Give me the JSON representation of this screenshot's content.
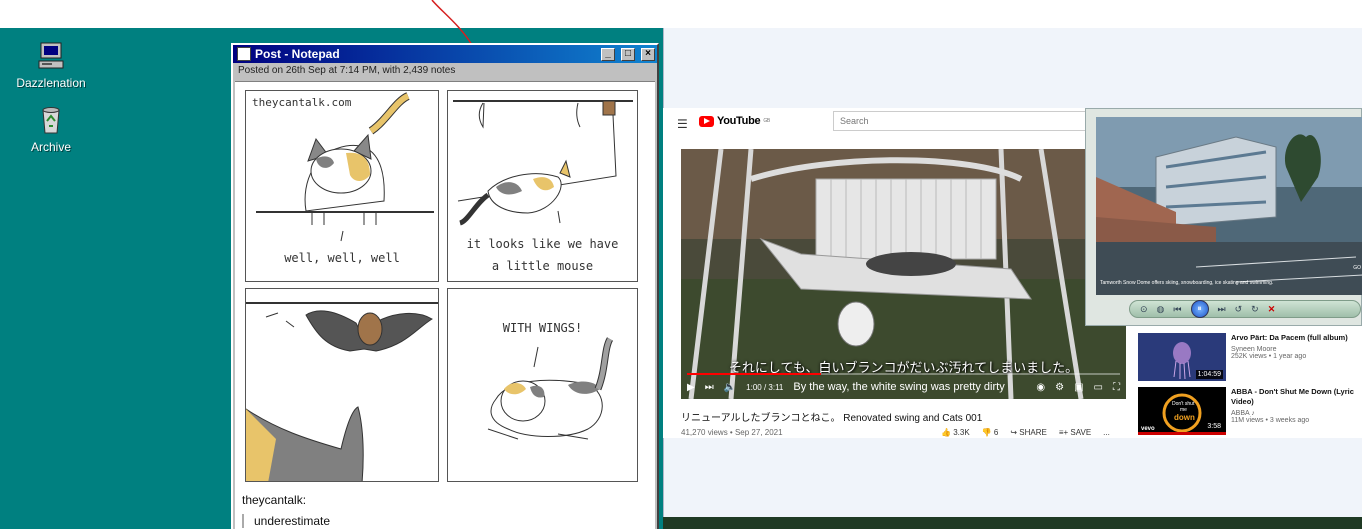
{
  "desktop": {
    "icons": [
      {
        "label": "Dazzlenation",
        "icon": "computer-icon"
      },
      {
        "label": "Archive",
        "icon": "recycle-bin-icon"
      }
    ]
  },
  "notepad": {
    "title": "Post - Notepad",
    "subtitle": "Posted on 26th Sep at 7:14 PM, with 2,439 notes",
    "buttons": {
      "minimize": "_",
      "maximize": "□",
      "close": "×"
    },
    "comic": {
      "watermark": "theycantalk.com",
      "panel1_caption": "well, well, well",
      "panel2_caption_line1": "it looks like we have",
      "panel2_caption_line2": "a little mouse",
      "panel4_caption": "WITH WINGS!"
    },
    "author": "theycantalk:",
    "quote": "underestimate"
  },
  "youtube": {
    "logo_text": "YouTube",
    "logo_sup": "GB",
    "search_placeholder": "Search",
    "video": {
      "subtitle_jp": "それにしても、白いブランコがだいぶ汚れてしまいました。",
      "subtitle_en": "By the way, the white swing was pretty dirty",
      "time": "1:00 / 3:11",
      "progress": 0.31,
      "title": "リニューアルしたブランコとねこ。 Renovated swing and Cats 001",
      "meta": "41,270 views • Sep 27, 2021",
      "likes": "3.3K",
      "dislikes": "6",
      "share": "SHARE",
      "save": "SAVE",
      "more": "..."
    },
    "recommendations": [
      {
        "title": "Arvo Pärt: Da Pacem (full album)",
        "channel": "Syneen Moore",
        "views": "252K views • 1 year ago",
        "duration": "1:04:59"
      },
      {
        "title": "ABBA - Don't Shut Me Down (Lyric Video)",
        "channel": "ABBA ♪",
        "views": "11M views • 3 weeks ago",
        "duration": "3:58",
        "thumb_text_1": "Don't shut",
        "thumb_text_2": "me",
        "thumb_text_3": "down",
        "thumb_brand": "vevo"
      }
    ]
  },
  "media_player": {
    "caption": "Tamworth Snow Dome offers skiing, snowboarding, ice skating and swimming.",
    "watermark": "GO"
  }
}
